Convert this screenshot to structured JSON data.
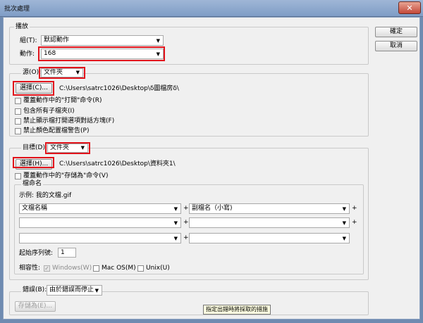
{
  "window": {
    "title": "批次處理"
  },
  "buttons": {
    "ok": "確定",
    "cancel": "取消"
  },
  "play": {
    "group_label": "播放",
    "set_label": "組(T):",
    "set_value": "默認動作",
    "action_label": "動作:",
    "action_value": "168"
  },
  "source": {
    "label": "源(O):",
    "value": "文件夾",
    "choose_button": "選擇(C)...",
    "path": "C:\\Users\\satrc1026\\Desktop\\δ圖檔房δ\\",
    "options": [
      "覆蓋動作中的\"打開\"命令(R)",
      "包含所有子檔夾(I)",
      "禁止顯示檔打開選項對話方塊(F)",
      "禁止顏色配置檔警告(P)"
    ]
  },
  "destination": {
    "label": "目標(D):",
    "value": "文件夾",
    "choose_button": "選擇(H)...",
    "path": "C:\\Users\\satrc1026\\Desktop\\資料夾1\\",
    "override_save": "覆蓋動作中的\"存儲為\"命令(V)"
  },
  "naming": {
    "group_label": "檔命名",
    "example": "示例: 我的文檔.gif",
    "rows": [
      [
        "文檔名稱",
        "副檔名（小寫)"
      ],
      [
        "",
        ""
      ],
      [
        "",
        ""
      ]
    ],
    "plus": "+",
    "serial_label": "起始序列號:",
    "serial_value": "1",
    "compat_label": "相容性:",
    "compat_windows": "Windows(W)",
    "compat_mac": "Mac OS(M)",
    "compat_unix": "Unix(U)"
  },
  "errors": {
    "label": "錯誤(B):",
    "value": "由於錯誤而停止",
    "save_as_button": "存儲為(E)..."
  },
  "tooltip": "指定出錯時將採取的措施",
  "colors": {
    "highlight": "#e1131b",
    "titlebar": "#7f9dc6",
    "dialog_bg": "#f0f0f0"
  }
}
